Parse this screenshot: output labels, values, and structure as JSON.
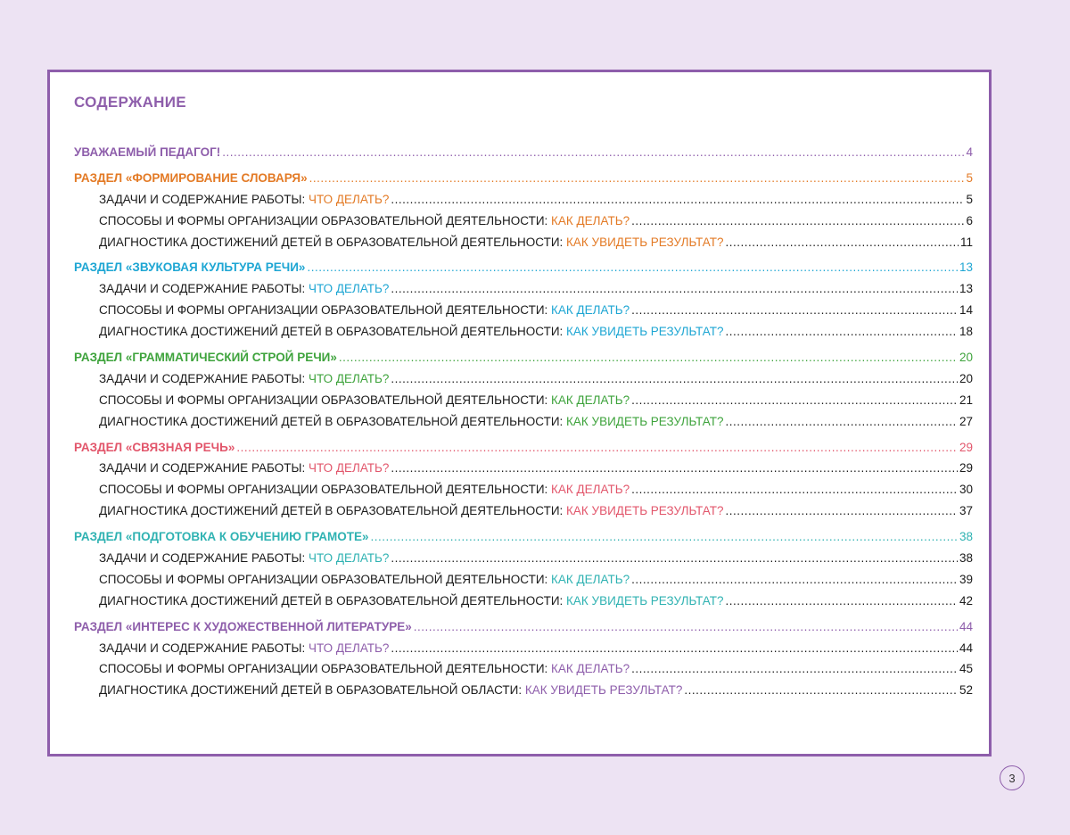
{
  "colors": {
    "purple": "#8e5eab",
    "orange": "#e37a25",
    "blue": "#1ea6d3",
    "green": "#3ea33c",
    "pink": "#e2566b",
    "teal": "#2fb2b2",
    "violet": "#8e5eab",
    "background": "#ede3f3"
  },
  "title": "СОДЕРЖАНИЕ",
  "intro": {
    "text": "УВАЖАЕМЫЙ ПЕДАГОГ!",
    "page": "4",
    "color": "#8e5eab"
  },
  "sections": [
    {
      "title": "РАЗДЕЛ «ФОРМИРОВАНИЕ СЛОВАРЯ»",
      "page": "5",
      "color": "#e37a25",
      "items": [
        {
          "prefix": "ЗАДАЧИ И СОДЕРЖАНИЕ РАБОТЫ: ",
          "highlight": "ЧТО ДЕЛАТЬ?",
          "page": "5"
        },
        {
          "prefix": "СПОСОБЫ И ФОРМЫ ОРГАНИЗАЦИИ ОБРАЗОВАТЕЛЬНОЙ ДЕЯТЕЛЬНОСТИ: ",
          "highlight": "КАК ДЕЛАТЬ? ",
          "page": "6"
        },
        {
          "prefix": "ДИАГНОСТИКА ДОСТИЖЕНИЙ ДЕТЕЙ В ОБРАЗОВАТЕЛЬНОЙ ДЕЯТЕЛЬНОСТИ: ",
          "highlight": "КАК УВИДЕТЬ РЕЗУЛЬТАТ? ",
          "page": "11"
        }
      ]
    },
    {
      "title": "РАЗДЕЛ «ЗВУКОВАЯ КУЛЬТУРА РЕЧИ» ",
      "page": "13",
      "color": "#1ea6d3",
      "items": [
        {
          "prefix": "ЗАДАЧИ И СОДЕРЖАНИЕ РАБОТЫ: ",
          "highlight": "ЧТО ДЕЛАТЬ?",
          "page": "13"
        },
        {
          "prefix": "СПОСОБЫ И ФОРМЫ ОРГАНИЗАЦИИ ОБРАЗОВАТЕЛЬНОЙ ДЕЯТЕЛЬНОСТИ: ",
          "highlight": "КАК ДЕЛАТЬ?",
          "page": "14"
        },
        {
          "prefix": "ДИАГНОСТИКА ДОСТИЖЕНИЙ ДЕТЕЙ В ОБРАЗОВАТЕЛЬНОЙ ДЕЯТЕЛЬНОСТИ: ",
          "highlight": "КАК УВИДЕТЬ РЕЗУЛЬТАТ? ",
          "page": "18"
        }
      ]
    },
    {
      "title": "РАЗДЕЛ «ГРАММАТИЧЕСКИЙ СТРОЙ РЕЧИ» ",
      "page": "20",
      "color": "#3ea33c",
      "items": [
        {
          "prefix": "ЗАДАЧИ И СОДЕРЖАНИЕ РАБОТЫ: ",
          "highlight": "ЧТО ДЕЛАТЬ?",
          "page": "20"
        },
        {
          "prefix": "СПОСОБЫ И ФОРМЫ ОРГАНИЗАЦИИ ОБРАЗОВАТЕЛЬНОЙ ДЕЯТЕЛЬНОСТИ: ",
          "highlight": "КАК ДЕЛАТЬ? ",
          "page": "21"
        },
        {
          "prefix": "ДИАГНОСТИКА ДОСТИЖЕНИЙ ДЕТЕЙ В ОБРАЗОВАТЕЛЬНОЙ ДЕЯТЕЛЬНОСТИ: ",
          "highlight": "КАК УВИДЕТЬ РЕЗУЛЬТАТ? ",
          "page": "27"
        }
      ]
    },
    {
      "title": "РАЗДЕЛ «СВЯЗНАЯ РЕЧЬ» ",
      "page": "29",
      "color": "#e2566b",
      "items": [
        {
          "prefix": "ЗАДАЧИ И СОДЕРЖАНИЕ РАБОТЫ: ",
          "highlight": "ЧТО ДЕЛАТЬ?",
          "page": "29"
        },
        {
          "prefix": "СПОСОБЫ И ФОРМЫ ОРГАНИЗАЦИИ ОБРАЗОВАТЕЛЬНОЙ ДЕЯТЕЛЬНОСТИ: ",
          "highlight": "КАК ДЕЛАТЬ? ",
          "page": "30"
        },
        {
          "prefix": "ДИАГНОСТИКА ДОСТИЖЕНИЙ ДЕТЕЙ В ОБРАЗОВАТЕЛЬНОЙ ДЕЯТЕЛЬНОСТИ: ",
          "highlight": "КАК УВИДЕТЬ РЕЗУЛЬТАТ? ",
          "page": "37"
        }
      ]
    },
    {
      "title": "РАЗДЕЛ «ПОДГОТОВКА К ОБУЧЕНИЮ ГРАМОТЕ» ",
      "page": "38",
      "color": "#2fb2b2",
      "items": [
        {
          "prefix": "ЗАДАЧИ И СОДЕРЖАНИЕ РАБОТЫ: ",
          "highlight": "ЧТО ДЕЛАТЬ?",
          "page": "38"
        },
        {
          "prefix": "СПОСОБЫ И ФОРМЫ ОРГАНИЗАЦИИ ОБРАЗОВАТЕЛЬНОЙ ДЕЯТЕЛЬНОСТИ: ",
          "highlight": "КАК ДЕЛАТЬ? ",
          "page": "39"
        },
        {
          "prefix": "ДИАГНОСТИКА ДОСТИЖЕНИЙ ДЕТЕЙ В ОБРАЗОВАТЕЛЬНОЙ ДЕЯТЕЛЬНОСТИ: ",
          "highlight": "КАК УВИДЕТЬ РЕЗУЛЬТАТ? ",
          "page": "42"
        }
      ]
    },
    {
      "title": "РАЗДЕЛ «ИНТЕРЕС К ХУДОЖЕСТВЕННОЙ ЛИТЕРАТУРЕ» ",
      "page": "44",
      "color": "#8e5eab",
      "items": [
        {
          "prefix": "ЗАДАЧИ И СОДЕРЖАНИЕ РАБОТЫ: ",
          "highlight": "ЧТО ДЕЛАТЬ?",
          "page": "44"
        },
        {
          "prefix": "СПОСОБЫ И ФОРМЫ ОРГАНИЗАЦИИ ОБРАЗОВАТЕЛЬНОЙ ДЕЯТЕЛЬНОСТИ: ",
          "highlight": "КАК ДЕЛАТЬ?",
          "page": "45"
        },
        {
          "prefix": "ДИАГНОСТИКА ДОСТИЖЕНИЙ ДЕТЕЙ В ОБРАЗОВАТЕЛЬНОЙ ОБЛАСТИ: ",
          "highlight": "КАК УВИДЕТЬ РЕЗУЛЬТАТ?",
          "page": "52"
        }
      ]
    }
  ],
  "page_number": "3"
}
